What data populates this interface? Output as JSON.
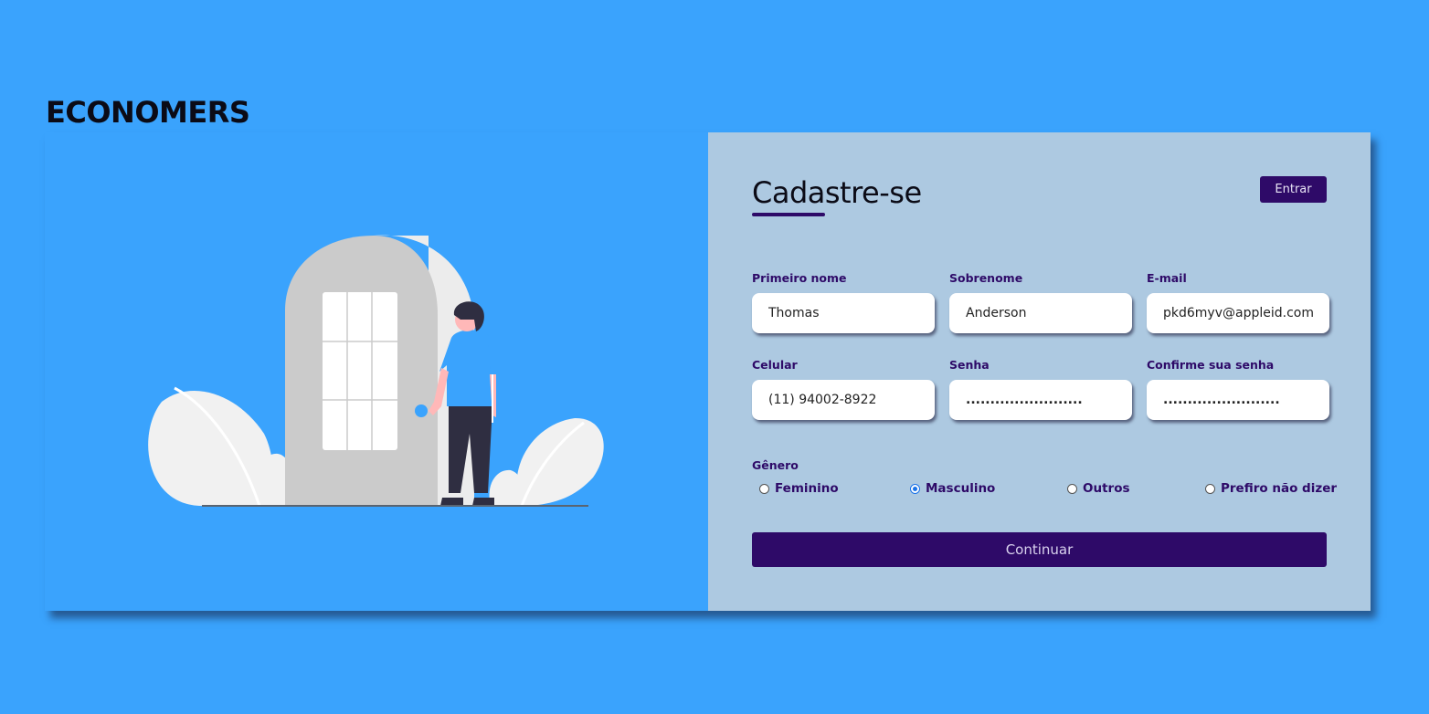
{
  "brand": "ECONOMERS",
  "form": {
    "title": "Cadastre-se",
    "login_button": "Entrar",
    "fields": {
      "first_name": {
        "label": "Primeiro nome",
        "value": "Thomas"
      },
      "last_name": {
        "label": "Sobrenome",
        "value": "Anderson"
      },
      "email": {
        "label": "E-mail",
        "value": "pkd6myv@appleid.com"
      },
      "phone": {
        "label": "Celular",
        "value": "(11) 94002-8922"
      },
      "password": {
        "label": "Senha",
        "value": "........................"
      },
      "confirm_password": {
        "label": "Confirme sua senha",
        "value": "........................"
      }
    },
    "gender": {
      "label": "Gênero",
      "options": [
        "Feminino",
        "Masculino",
        "Outros",
        "Prefiro não dizer"
      ],
      "selected": "Masculino"
    },
    "submit_button": "Continuar"
  },
  "colors": {
    "background": "#3aa3fd",
    "panel": "#adc9e1",
    "accent": "#2e0a68"
  },
  "illustration": {
    "icon": "person-at-door-illustration"
  }
}
